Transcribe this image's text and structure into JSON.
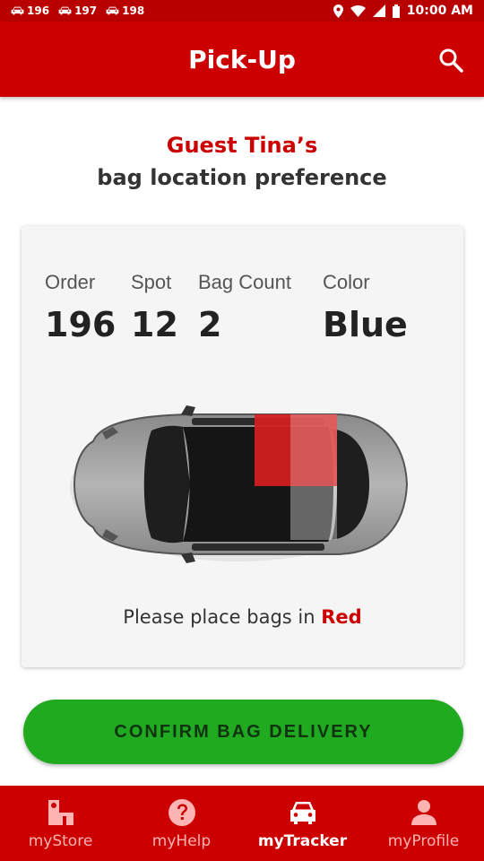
{
  "status_bar": {
    "notifications": [
      "196",
      "197",
      "198"
    ],
    "time": "10:00 AM"
  },
  "header": {
    "title": "Pick-Up",
    "search_icon": "search-icon"
  },
  "guest": {
    "name": "Guest Tina’s",
    "subtitle": "bag location preference"
  },
  "order_card": {
    "fields": [
      {
        "label": "Order",
        "value": "196"
      },
      {
        "label": "Spot",
        "value": "12"
      },
      {
        "label": "Bag Count",
        "value": "2"
      },
      {
        "label": "Color",
        "value": "Blue"
      }
    ],
    "instruction_prefix": "Please place bags in",
    "instruction_location": "Red",
    "highlight_color": "#cc0000"
  },
  "confirm_button": {
    "label": "CONFIRM BAG DELIVERY",
    "color": "#1faa1f"
  },
  "bottom_nav": {
    "items": [
      {
        "label": "myStore",
        "icon": "store-icon"
      },
      {
        "label": "myHelp",
        "icon": "help-icon"
      },
      {
        "label": "myTracker",
        "icon": "car-icon",
        "active": true
      },
      {
        "label": "myProfile",
        "icon": "person-icon"
      }
    ]
  },
  "colors": {
    "brand_red": "#cc0000",
    "status_red": "#b80000"
  }
}
